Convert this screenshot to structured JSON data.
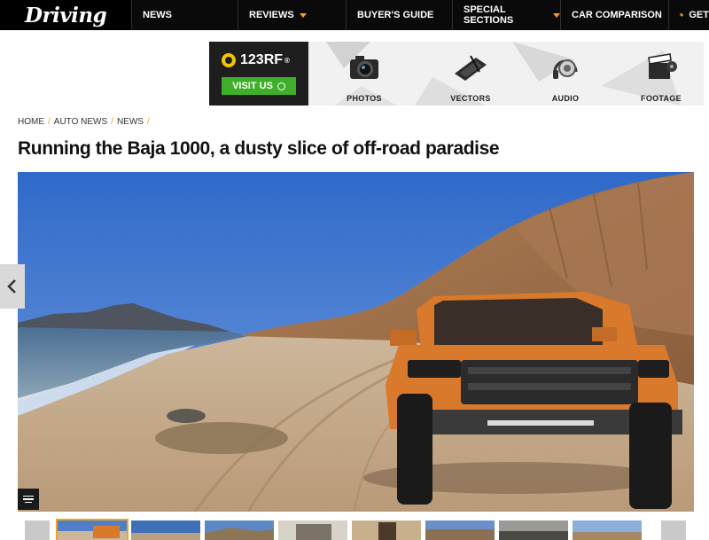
{
  "site": {
    "logo_text": "Driving"
  },
  "nav": {
    "items": [
      {
        "label": "NEWS",
        "has_caret": false
      },
      {
        "label": "REVIEWS",
        "has_caret": true
      },
      {
        "label": "BUYER'S GUIDE",
        "has_caret": false
      },
      {
        "label": "SPECIAL SECTIONS",
        "has_caret": true
      },
      {
        "label": "CAR COMPARISON",
        "has_caret": false
      },
      {
        "label": "GET",
        "icon": "price-tag-icon"
      }
    ]
  },
  "ad": {
    "brand": "123RF",
    "brand_mark": "®",
    "cta": "VISIT US",
    "categories": [
      {
        "label": "PHOTOS",
        "icon": "camera-icon"
      },
      {
        "label": "VECTORS",
        "icon": "drawing-tablet-icon"
      },
      {
        "label": "AUDIO",
        "icon": "headphones-icon"
      },
      {
        "label": "FOOTAGE",
        "icon": "clapperboard-icon"
      }
    ]
  },
  "breadcrumb": [
    "HOME",
    "AUTO NEWS",
    "NEWS"
  ],
  "breadcrumb_sep": "/",
  "article": {
    "title": "Running the Baja 1000, a dusty slice of off-road paradise"
  },
  "gallery": {
    "thumb_count": 9,
    "active_index": 0
  },
  "colors": {
    "nav_bg": "#0a0a0a",
    "accent": "#f4a11d",
    "ad_green": "#3fae2a",
    "truck_orange": "#d8792c"
  }
}
